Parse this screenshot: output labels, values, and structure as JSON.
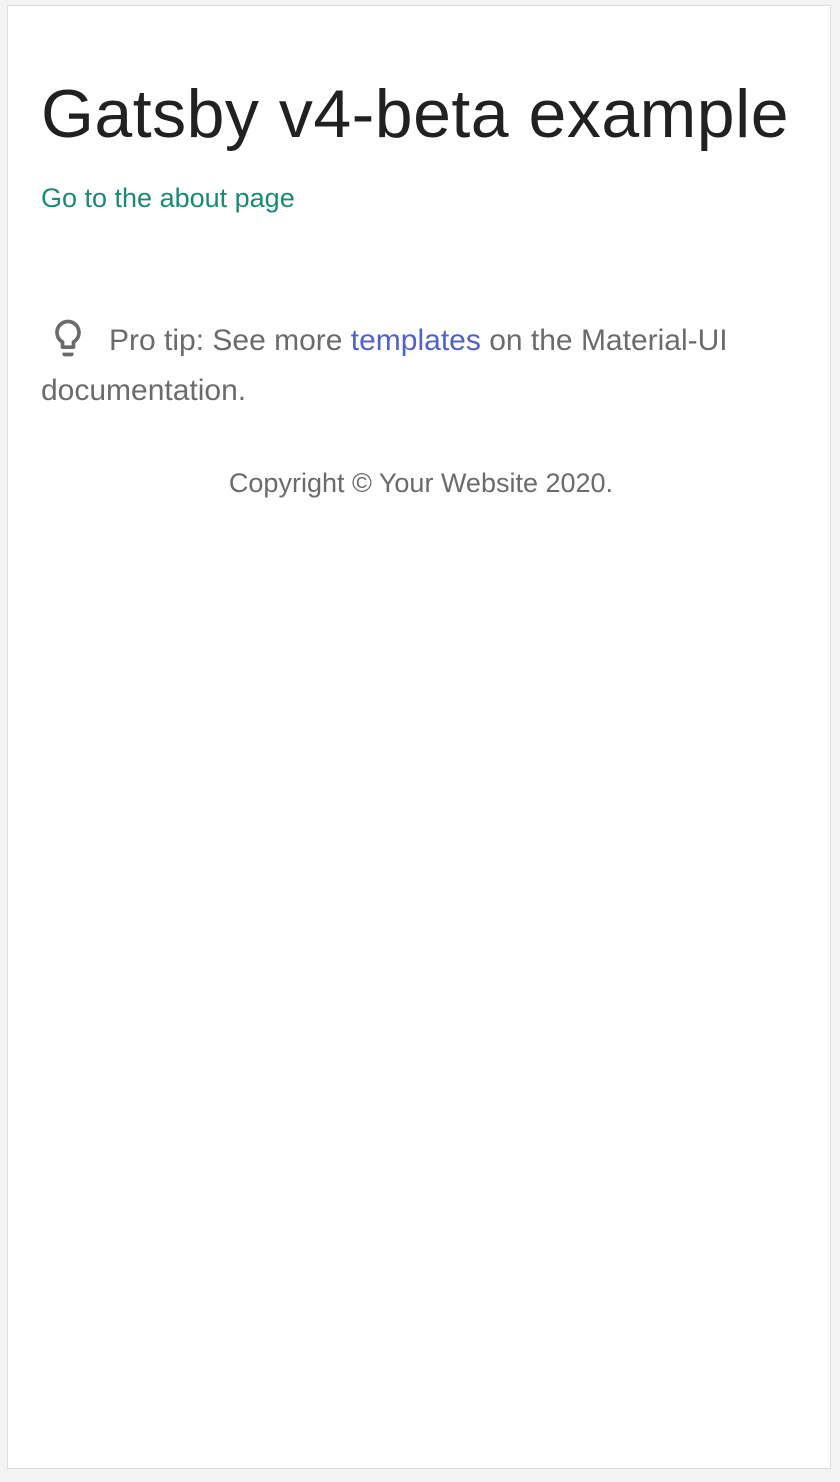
{
  "page": {
    "title": "Gatsby v4-beta example",
    "about_link": "Go to the about page"
  },
  "protip": {
    "icon": "lightbulb-icon",
    "prefix": "Pro tip: See more ",
    "link_text": "templates",
    "suffix": " on the Material-UI documentation."
  },
  "footer": {
    "copyright": "Copyright © Your Website 2020."
  },
  "colors": {
    "title": "#212121",
    "about_link": "#1a8a78",
    "templates_link": "#4f63c9",
    "secondary_text": "#6b6b6b",
    "background": "#ffffff"
  }
}
